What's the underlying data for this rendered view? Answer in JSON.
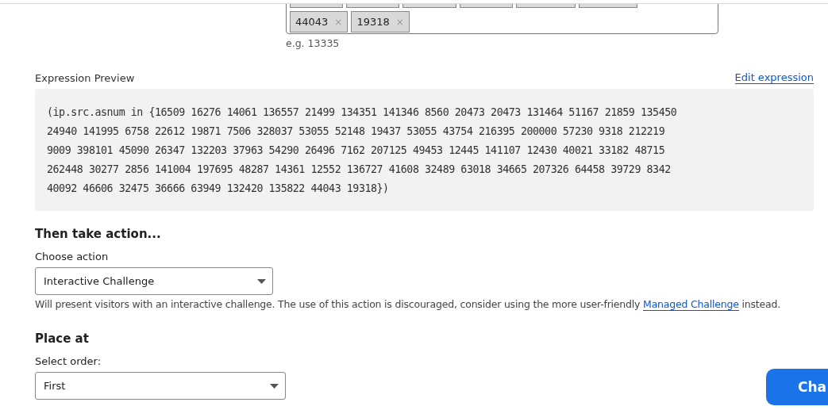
{
  "asn_field": {
    "tags": [
      {
        "value": "44043",
        "remove": "×"
      },
      {
        "value": "19318",
        "remove": "×"
      }
    ],
    "hint": "e.g. 13335"
  },
  "expression_preview": {
    "label": "Expression Preview",
    "edit_link": "Edit expression",
    "lines": [
      "(ip.src.asnum in {16509 16276 14061 136557 21499 134351 141346 8560 20473 20473 131464 51167 21859 135450",
      "24940 141995 6758 22612 19871 7506 328037 53055 52148 19437 53055 43754 216395 200000 57230 9318 212219",
      "9009 398101 45090 26347 132203 37963 54290 26496 7162 207125 49453 12445 141107 12430 40021 33182 48715",
      "262448 30277 2856 141004 197695 48287 14361 12552 136727 41608 32489 63018 34665 207326 64458 39729 8342",
      "40092 46606 32475 36666 63949 132420 135822 44043 19318})"
    ]
  },
  "action": {
    "heading": "Then take action...",
    "label": "Choose action",
    "value": "Interactive Challenge",
    "note_before": "Will present visitors with an interactive challenge. The use of this action is discouraged, consider using the more user-friendly ",
    "note_link": "Managed Challenge",
    "note_after": " instead."
  },
  "place": {
    "heading": "Place at",
    "label": "Select order:",
    "value": "First"
  },
  "chat_button": {
    "label": "Cha"
  }
}
